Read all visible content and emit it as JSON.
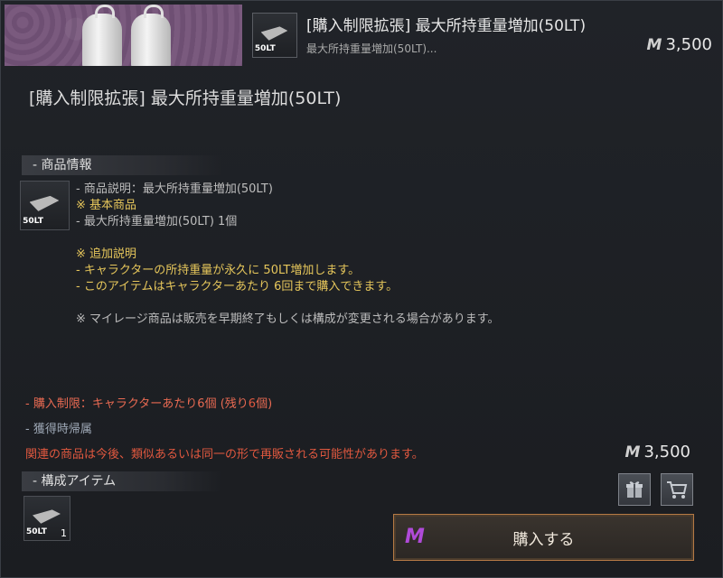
{
  "header": {
    "item_title": "[購入制限拡張] 最大所持重量増加(50LT)",
    "item_subtitle": "最大所持重量増加(50LT)...",
    "price": "3,500",
    "thumb_label": "50LT"
  },
  "main": {
    "title": "[購入制限拡張] 最大所持重量増加(50LT)"
  },
  "product_info": {
    "heading": "- 商品情報",
    "thumb_label": "50LT",
    "lines": [
      "- 商品説明：最大所持重量増加(50LT)",
      "※ 基本商品",
      "- 最大所持重量増加(50LT) 1個",
      "",
      "※ 追加説明",
      "- キャラクターの所持重量が永久に 50LT増加します。",
      "- このアイテムはキャラクターあたり 6回まで購入できます。",
      "",
      "※ マイレージ商品は販売を早期終了もしくは構成が変更される場合があります。"
    ]
  },
  "limits": {
    "purchase_limit_prefix": "- 購入制限：キャラクターあたり6個 (残り",
    "purchase_limit_remaining": "6",
    "purchase_limit_suffix": "個)",
    "binding": "- 獲得時帰属",
    "resale_notice": "関連の商品は今後、類似あるいは同一の形で再販される可能性があります。"
  },
  "footer": {
    "price": "3,500",
    "components_heading": "- 構成アイテム",
    "component_thumb_label": "50LT",
    "component_qty": "1",
    "buy_label": "購入する"
  },
  "icons": {
    "currency": "mileage-icon",
    "gift": "gift-icon",
    "cart": "cart-icon"
  },
  "colors": {
    "accent_yellow": "#e6c65b",
    "warning_red": "#e0583f",
    "buy_border": "#b57a45",
    "mileage_purple": "#b04ad8"
  }
}
